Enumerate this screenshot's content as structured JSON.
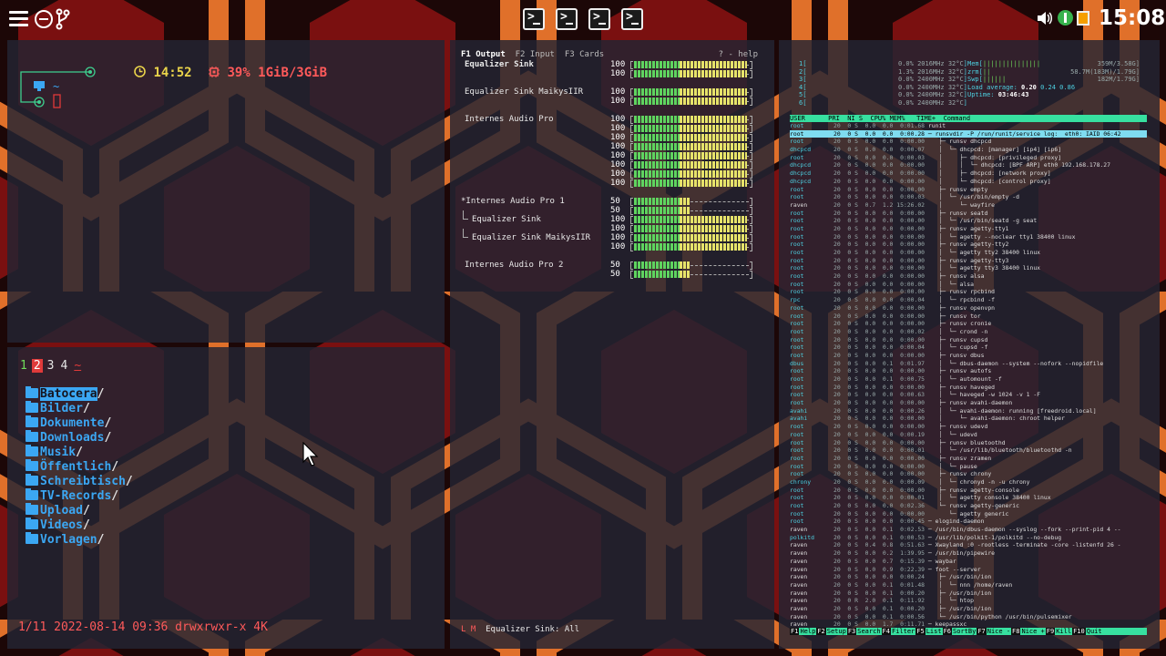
{
  "topbar": {
    "left_icons": [
      "menu-icon",
      "circle-minus-icon",
      "git-branch-icon"
    ],
    "terminal_launchers": [
      "terminal-icon",
      "terminal-icon",
      "terminal-icon",
      "terminal-icon"
    ],
    "tray_icons": [
      "volume-icon",
      "vpn-icon",
      "battery-icon"
    ],
    "clock": "15:08"
  },
  "status_pane": {
    "tree_icons": [
      "circle-node-icon",
      "monitor-icon",
      "circle-node-icon",
      "phone-icon"
    ],
    "home_symbol": "~",
    "clock": "14:52",
    "cpu_mem": "39% 1GiB/3GiB"
  },
  "file_manager": {
    "tabs": [
      "1",
      "2",
      "3",
      "4",
      "~"
    ],
    "active_tab": "2",
    "entries": [
      {
        "name": "Batocera",
        "icon": "folder-icon",
        "selected": true
      },
      {
        "name": "Bilder",
        "icon": "folder-icon"
      },
      {
        "name": "Dokumente",
        "icon": "folder-icon"
      },
      {
        "name": "Downloads",
        "icon": "download-folder-icon"
      },
      {
        "name": "Musik",
        "icon": "folder-icon"
      },
      {
        "name": "Öffentlich",
        "icon": "folder-icon"
      },
      {
        "name": "Schreibtisch",
        "icon": "folder-icon"
      },
      {
        "name": "TV-Records",
        "icon": "folder-icon"
      },
      {
        "name": "Upload",
        "icon": "folder-icon"
      },
      {
        "name": "Videos",
        "icon": "film-folder-icon"
      },
      {
        "name": "Vorlagen",
        "icon": "folder-icon"
      }
    ],
    "trailing": "/",
    "status": "1/11 2022-08-14 09:36 drwxrwxr-x 4K"
  },
  "mixer": {
    "tabs": [
      "F1 Output",
      "F2 Input",
      "F3 Cards"
    ],
    "active_tab": "F1 Output",
    "help": "? - help",
    "devices": [
      {
        "name": "Equalizer Sink",
        "levels": [
          100,
          100
        ],
        "bold": true
      },
      {
        "name": "Equalizer Sink MaikysIIR",
        "levels": [
          100,
          100
        ]
      },
      {
        "name": "Internes Audio Pro",
        "levels": [
          100,
          100,
          100,
          100,
          100,
          100,
          100,
          100
        ]
      },
      {
        "name": "*Internes Audio Pro 1",
        "levels": [
          50,
          50
        ]
      },
      {
        "name": "Equalizer Sink",
        "levels": [
          100,
          100
        ],
        "child": true
      },
      {
        "name": "Equalizer Sink MaikysIIR",
        "levels": [
          100,
          100
        ],
        "child": true
      },
      {
        "name": "Internes Audio Pro 2",
        "levels": [
          50,
          50
        ]
      }
    ],
    "status_mode": "L M",
    "status_text": "Equalizer Sink: All"
  },
  "htop": {
    "cpus": [
      {
        "n": "1",
        "pct": "0.0%",
        "freq": "2016MHz",
        "temp": "32°C"
      },
      {
        "n": "2",
        "pct": "1.3%",
        "freq": "2016MHz",
        "temp": "32°C"
      },
      {
        "n": "3",
        "pct": "0.0%",
        "freq": "2400MHz",
        "temp": "32°C"
      },
      {
        "n": "4",
        "pct": "0.0%",
        "freq": "2400MHz",
        "temp": "32°C"
      },
      {
        "n": "5",
        "pct": "0.0%",
        "freq": "2400MHz",
        "temp": "32°C"
      },
      {
        "n": "6",
        "pct": "0.0%",
        "freq": "2400MHz",
        "temp": "32°C"
      }
    ],
    "mem": {
      "label": "Mem",
      "value": "359M/3.58G"
    },
    "zrm": {
      "label": "zrm",
      "value": "58.7M(183M)/1.79G"
    },
    "swp": {
      "label": "Swp",
      "value": "182M/1.79G"
    },
    "load_label": "Load average:",
    "load": [
      "0.20",
      "0.24",
      "0.86"
    ],
    "uptime_label": "Uptime:",
    "uptime": "03:46:43",
    "header": "USER      PRI  NI S  CPU% MEM%   TIME+  Command",
    "processes": [
      {
        "u": "root",
        "n": "20  0 S  0.0  0.0  0:01.68",
        "c": "runit"
      },
      {
        "u": "root",
        "n": "20  0 S  0.0  0.0  0:00.28",
        "c": "─ runsvdir -P /run/runit/service log:  eth0: IAID 06:42"
      },
      {
        "u": "root",
        "n": "20  0 S  0.0  0.0  0:00.00",
        "c": "   ├─ runsv dhcpcd"
      },
      {
        "u": "dhcpcd",
        "n": "20  0 S  0.0  0.0  0:00.07",
        "c": "   │  └─ dhcpcd: [manager] [ip4] [ip6]"
      },
      {
        "u": "root",
        "n": "20  0 S  0.0  0.0  0:00.03",
        "c": "   │     ├─ dhcpcd: [privileged proxy]"
      },
      {
        "u": "dhcpcd",
        "n": "20  0 S  0.0  0.0  0:00.00",
        "c": "   │     │  └─ dhcpcd: [BPF ARP] eth0 192.168.178.27"
      },
      {
        "u": "dhcpcd",
        "n": "20  0 S  0.0  0.0  0:00.00",
        "c": "   │     ├─ dhcpcd: [network proxy]"
      },
      {
        "u": "dhcpcd",
        "n": "20  0 S  0.0  0.0  0:00.00",
        "c": "   │     └─ dhcpcd: [control proxy]"
      },
      {
        "u": "root",
        "n": "20  0 S  0.0  0.0  0:00.00",
        "c": "   ├─ runsv empty"
      },
      {
        "u": "root",
        "n": "20  0 S  0.0  0.0  0:00.03",
        "c": "   │  └─ /usr/bin/empty -d"
      },
      {
        "u": "raven",
        "n": "20  0 S  0.7  1.2 15:26.02",
        "c": "   │     └─ wayfire"
      },
      {
        "u": "root",
        "n": "20  0 S  0.0  0.0  0:00.00",
        "c": "   ├─ runsv seatd"
      },
      {
        "u": "root",
        "n": "20  0 S  0.0  0.0  0:00.00",
        "c": "   │  └─ /usr/bin/seatd -g seat"
      },
      {
        "u": "root",
        "n": "20  0 S  0.0  0.0  0:00.00",
        "c": "   ├─ runsv agetty-tty1"
      },
      {
        "u": "root",
        "n": "20  0 S  0.0  0.0  0:00.00",
        "c": "   │  └─ agetty --noclear tty1 38400 linux"
      },
      {
        "u": "root",
        "n": "20  0 S  0.0  0.0  0:00.00",
        "c": "   ├─ runsv agetty-tty2"
      },
      {
        "u": "root",
        "n": "20  0 S  0.0  0.0  0:00.00",
        "c": "   │  └─ agetty tty2 38400 linux"
      },
      {
        "u": "root",
        "n": "20  0 S  0.0  0.0  0:00.00",
        "c": "   ├─ runsv agetty-tty3"
      },
      {
        "u": "root",
        "n": "20  0 S  0.0  0.0  0:00.00",
        "c": "   │  └─ agetty tty3 38400 linux"
      },
      {
        "u": "root",
        "n": "20  0 S  0.0  0.0  0:00.00",
        "c": "   ├─ runsv alsa"
      },
      {
        "u": "root",
        "n": "20  0 S  0.0  0.0  0:00.00",
        "c": "   │  └─ alsa"
      },
      {
        "u": "root",
        "n": "20  0 S  0.0  0.0  0:00.00",
        "c": "   ├─ runsv rpcbind"
      },
      {
        "u": "rpc",
        "n": "20  0 S  0.0  0.0  0:00.04",
        "c": "   │  └─ rpcbind -f"
      },
      {
        "u": "root",
        "n": "20  0 S  0.0  0.0  0:00.00",
        "c": "   ├─ runsv openvpn"
      },
      {
        "u": "root",
        "n": "20  0 S  0.0  0.0  0:00.00",
        "c": "   ├─ runsv tor"
      },
      {
        "u": "root",
        "n": "20  0 S  0.0  0.0  0:00.00",
        "c": "   ├─ runsv cronie"
      },
      {
        "u": "root",
        "n": "20  0 S  0.0  0.0  0:00.02",
        "c": "   │  └─ crond -n"
      },
      {
        "u": "root",
        "n": "20  0 S  0.0  0.0  0:00.00",
        "c": "   ├─ runsv cupsd"
      },
      {
        "u": "root",
        "n": "20  0 S  0.0  0.0  0:00.04",
        "c": "   │  └─ cupsd -f"
      },
      {
        "u": "root",
        "n": "20  0 S  0.0  0.0  0:00.00",
        "c": "   ├─ runsv dbus"
      },
      {
        "u": "dbus",
        "n": "20  0 S  0.0  0.1  0:01.97",
        "c": "   │  └─ dbus-daemon --system --nofork --nopidfile"
      },
      {
        "u": "root",
        "n": "20  0 S  0.0  0.0  0:00.00",
        "c": "   ├─ runsv autofs"
      },
      {
        "u": "root",
        "n": "20  0 S  0.0  0.1  0:00.75",
        "c": "   │  └─ automount -f"
      },
      {
        "u": "root",
        "n": "20  0 S  0.0  0.0  0:00.00",
        "c": "   ├─ runsv haveged"
      },
      {
        "u": "root",
        "n": "20  0 S  0.0  0.0  0:00.63",
        "c": "   │  └─ haveged -w 1024 -v 1 -F"
      },
      {
        "u": "root",
        "n": "20  0 S  0.0  0.0  0:00.00",
        "c": "   ├─ runsv avahi-daemon"
      },
      {
        "u": "avahi",
        "n": "20  0 S  0.0  0.0  0:00.26",
        "c": "   │  └─ avahi-daemon: running [freedroid.local]"
      },
      {
        "u": "avahi",
        "n": "20  0 S  0.0  0.0  0:00.00",
        "c": "   │     └─ avahi-daemon: chroot helper"
      },
      {
        "u": "root",
        "n": "20  0 S  0.0  0.0  0:00.00",
        "c": "   ├─ runsv udevd"
      },
      {
        "u": "root",
        "n": "20  0 S  0.0  0.0  0:00.19",
        "c": "   │  └─ udevd"
      },
      {
        "u": "root",
        "n": "20  0 S  0.0  0.0  0:00.00",
        "c": "   ├─ runsv bluetoothd"
      },
      {
        "u": "root",
        "n": "20  0 S  0.0  0.0  0:00.01",
        "c": "   │  └─ /usr/lib/bluetooth/bluetoothd -n"
      },
      {
        "u": "root",
        "n": "20  0 S  0.0  0.0  0:00.00",
        "c": "   ├─ runsv zramen"
      },
      {
        "u": "root",
        "n": "20  0 S  0.0  0.0  0:00.00",
        "c": "   │  └─ pause"
      },
      {
        "u": "root",
        "n": "20  0 S  0.0  0.0  0:00.00",
        "c": "   ├─ runsv chrony"
      },
      {
        "u": "chrony",
        "n": "20  0 S  0.0  0.0  0:00.09",
        "c": "   │  └─ chronyd -n -u chrony"
      },
      {
        "u": "root",
        "n": "20  0 S  0.0  0.0  0:00.00",
        "c": "   ├─ runsv agetty-console"
      },
      {
        "u": "root",
        "n": "20  0 S  0.0  0.0  0:00.01",
        "c": "   │  └─ agetty console 38400 linux"
      },
      {
        "u": "root",
        "n": "20  0 S  0.0  0.0  0:02.36",
        "c": "   └─ runsv agetty-generic"
      },
      {
        "u": "root",
        "n": "20  0 S  0.0  0.0  0:00.00",
        "c": "      └─ agetty generic"
      },
      {
        "u": "root",
        "n": "20  0 S  0.0  0.0  0:00.45",
        "c": "─ elogind-daemon"
      },
      {
        "u": "raven",
        "n": "20  0 S  0.0  0.1  0:02.53",
        "c": "─ /usr/bin/dbus-daemon --syslog --fork --print-pid 4 --"
      },
      {
        "u": "polkitd",
        "n": "20  0 S  0.0  0.1  0:00.53",
        "c": "─ /usr/lib/polkit-1/polkitd --no-debug"
      },
      {
        "u": "raven",
        "n": "20  0 S  0.4  0.8  0:51.63",
        "c": "─ Xwayland :0 -rootless -terminate -core -listenfd 26 -"
      },
      {
        "u": "raven",
        "n": "20  0 S  0.0  0.2  1:39.95",
        "c": "─ /usr/bin/pipewire"
      },
      {
        "u": "raven",
        "n": "20  0 S  0.0  0.7  0:15.39",
        "c": "─ waybar"
      },
      {
        "u": "raven",
        "n": "20  0 S  0.0  0.9  0:22.39",
        "c": "─ foot --server"
      },
      {
        "u": "raven",
        "n": "20  0 S  0.0  0.0  0:00.24",
        "c": "   ├─ /usr/bin/ion"
      },
      {
        "u": "raven",
        "n": "20  0 S  0.0  0.1  0:01.48",
        "c": "   │  └─ nnn /home/raven"
      },
      {
        "u": "raven",
        "n": "20  0 S  0.0  0.1  0:00.20",
        "c": "   ├─ /usr/bin/ion"
      },
      {
        "u": "raven",
        "n": "20  0 R  2.0  0.1  0:11.92",
        "c": "   │  └─ htop"
      },
      {
        "u": "raven",
        "n": "20  0 S  0.0  0.1  0:00.20",
        "c": "   ├─ /usr/bin/ion"
      },
      {
        "u": "raven",
        "n": "20  0 S  0.0  0.1  0:00.56",
        "c": "   └─ /usr/bin/python /usr/bin/pulsemixer"
      },
      {
        "u": "raven",
        "n": "20  0 S  0.0  1.7  0:11.71",
        "c": "─ keepassxc"
      }
    ],
    "footer": [
      {
        "k": "F1",
        "l": "Help"
      },
      {
        "k": "F2",
        "l": "Setup"
      },
      {
        "k": "F3",
        "l": "Search"
      },
      {
        "k": "F4",
        "l": "Filter"
      },
      {
        "k": "F5",
        "l": "List"
      },
      {
        "k": "F6",
        "l": "SortBy"
      },
      {
        "k": "F7",
        "l": "Nice -"
      },
      {
        "k": "F8",
        "l": "Nice +"
      },
      {
        "k": "F9",
        "l": "Kill"
      },
      {
        "k": "F10",
        "l": "Quit"
      }
    ]
  }
}
